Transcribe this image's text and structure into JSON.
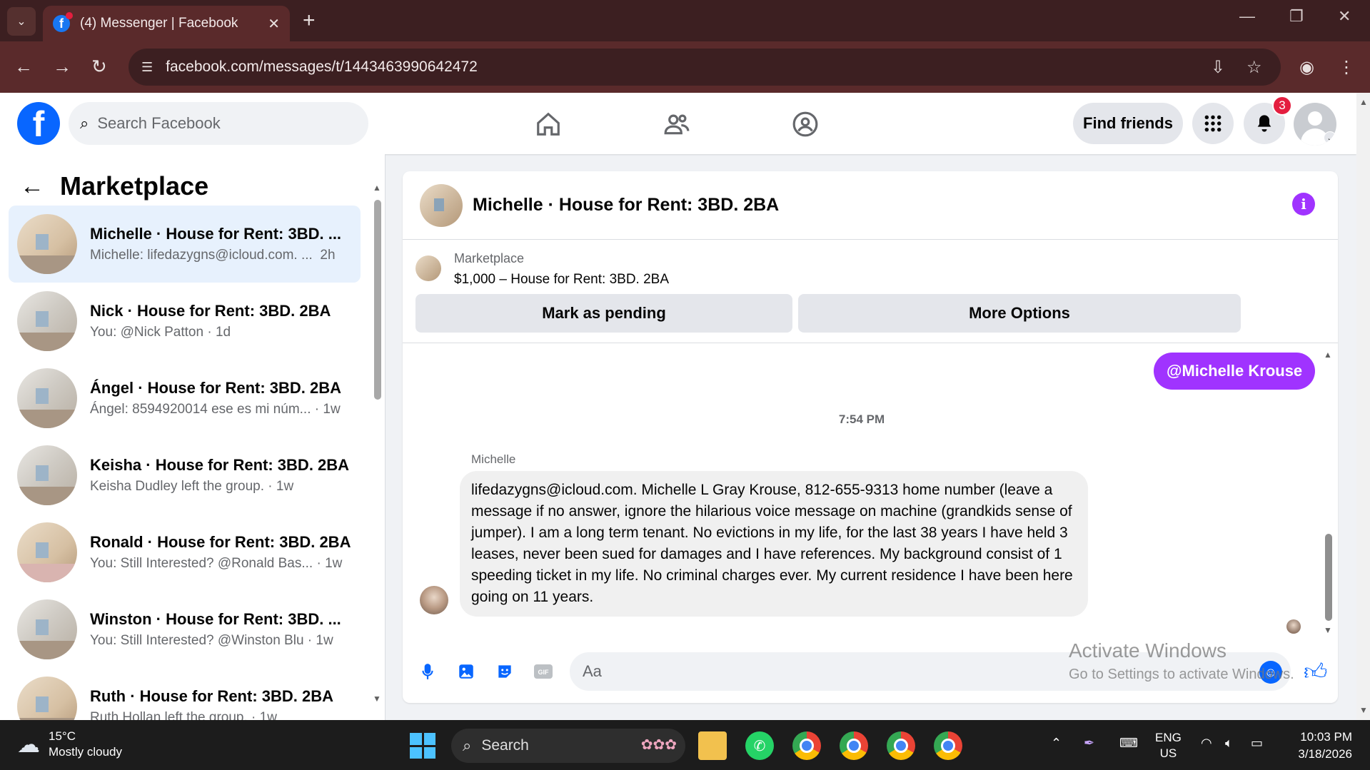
{
  "browser": {
    "tab_title": "(4) Messenger | Facebook",
    "url": "facebook.com/messages/t/1443463990642472"
  },
  "fb_header": {
    "search_placeholder": "Search Facebook",
    "find_friends_label": "Find friends",
    "notification_count": "3",
    "brand_color": "#0866ff"
  },
  "sidebar": {
    "title": "Marketplace",
    "conversations": [
      {
        "name": "Michelle · House for Rent: 3BD. ...",
        "preview": "Michelle: lifedazygns@icloud.com. ...",
        "time": "2h"
      },
      {
        "name": "Nick · House for Rent: 3BD. 2BA",
        "preview": "You: @Nick Patton",
        "time": "1d"
      },
      {
        "name": "Ángel · House for Rent: 3BD. 2BA",
        "preview": "Ángel: 8594920014 ese es mi núm...",
        "time": "1w"
      },
      {
        "name": "Keisha · House for Rent: 3BD. 2BA",
        "preview": "Keisha Dudley left the group.",
        "time": "1w"
      },
      {
        "name": "Ronald · House for Rent: 3BD. 2BA",
        "preview": "You: Still Interested? @Ronald Bas...",
        "time": "1w"
      },
      {
        "name": "Winston · House for Rent: 3BD. ...",
        "preview": "You: Still Interested? @Winston Blu",
        "time": "1w"
      },
      {
        "name": "Ruth · House for Rent: 3BD. 2BA",
        "preview": "Ruth Hollan left the group.",
        "time": "1w"
      }
    ]
  },
  "chat": {
    "title": "Michelle · House for Rent: 3BD. 2BA",
    "marketplace_label": "Marketplace",
    "listing": "$1,000 – House for Rent: 3BD. 2BA",
    "mark_pending_label": "Mark as pending",
    "more_options_label": "More Options",
    "outgoing_message": "@Michelle Krouse",
    "timestamp": "7:54 PM",
    "sender_name": "Michelle",
    "incoming_message": "lifedazygns@icloud.com. Michelle L Gray Krouse, 812-655-9313 home number (leave a message if no answer, ignore the hilarious voice message on machine (grandkids sense of jumper).  I am a long term tenant.  No evictions in my life, for the last 38 years I have held 3 leases, never been sued for damages and I have references.  My background consist of 1 speeding ticket in my life.  No criminal charges ever.  My current residence I have been here going on 11 years.",
    "composer_placeholder": "Aa",
    "accent_color": "#a033ff"
  },
  "watermark": {
    "line1": "Activate Windows",
    "line2": "Go to Settings to activate Windows."
  },
  "taskbar": {
    "weather_temp": "15°C",
    "weather_desc": "Mostly cloudy",
    "search_label": "Search",
    "lang_line1": "ENG",
    "lang_line2": "US",
    "time": "10:03 PM",
    "date": "3/18/2026"
  }
}
